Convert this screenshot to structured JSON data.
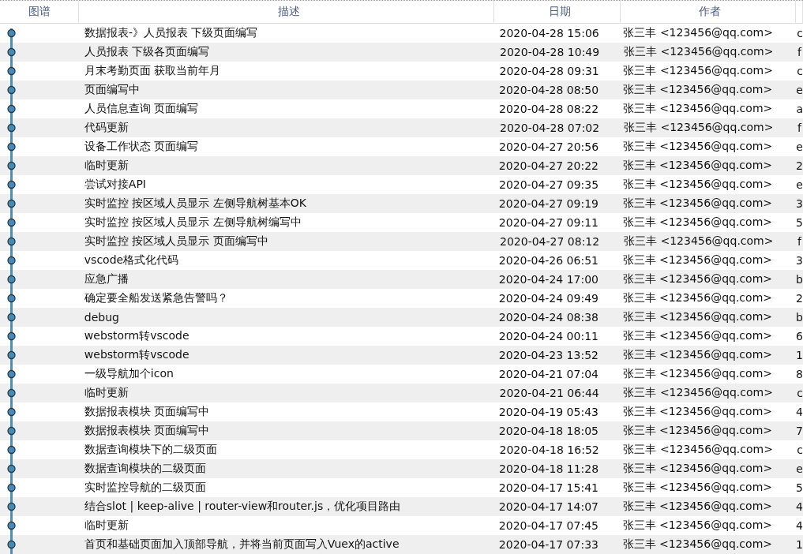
{
  "columns": [
    "图谱",
    "描述",
    "日期",
    "作者"
  ],
  "rows": [
    {
      "description": "数据报表-》人员报表 下级页面编写",
      "date": "2020-04-28 15:06",
      "author": "张三丰 <123456@qq.com>",
      "column_5": "c"
    },
    {
      "description": "人员报表 下级各页面编写",
      "date": "2020-04-28 10:49",
      "author": "张三丰 <123456@qq.com>",
      "column_5": "f"
    },
    {
      "description": "月末考勤页面 获取当前年月",
      "date": "2020-04-28 09:31",
      "author": "张三丰 <123456@qq.com>",
      "column_5": "c"
    },
    {
      "description": "页面编写中",
      "date": "2020-04-28 08:50",
      "author": "张三丰 <123456@qq.com>",
      "column_5": "e"
    },
    {
      "description": "人员信息查询 页面编写",
      "date": "2020-04-28 08:22",
      "author": "张三丰 <123456@qq.com>",
      "column_5": "a"
    },
    {
      "description": "代码更新",
      "date": "2020-04-28 07:02",
      "author": "张三丰 <123456@qq.com>",
      "column_5": "f"
    },
    {
      "description": "设备工作状态 页面编写",
      "date": "2020-04-27 20:56",
      "author": "张三丰 <123456@qq.com>",
      "column_5": "e"
    },
    {
      "description": "临时更新",
      "date": "2020-04-27 20:22",
      "author": "张三丰 <123456@qq.com>",
      "column_5": "2"
    },
    {
      "description": "尝试对接API",
      "date": "2020-04-27 09:35",
      "author": "张三丰 <123456@qq.com>",
      "column_5": "e"
    },
    {
      "description": "实时监控 按区域人员显示 左侧导航树基本OK",
      "date": "2020-04-27 09:19",
      "author": "张三丰 <123456@qq.com>",
      "column_5": "3"
    },
    {
      "description": "实时监控 按区域人员显示 左侧导航树编写中",
      "date": "2020-04-27 09:11",
      "author": "张三丰 <123456@qq.com>",
      "column_5": "5"
    },
    {
      "description": "实时监控 按区域人员显示 页面编写中",
      "date": "2020-04-27 08:12",
      "author": "张三丰 <123456@qq.com>",
      "column_5": "f"
    },
    {
      "description": "vscode格式化代码",
      "date": "2020-04-26 06:51",
      "author": "张三丰 <123456@qq.com>",
      "column_5": "3"
    },
    {
      "description": "应急广播",
      "date": "2020-04-24 17:00",
      "author": "张三丰 <123456@qq.com>",
      "column_5": "b"
    },
    {
      "description": "确定要全船发送紧急告警吗？",
      "date": "2020-04-24 09:49",
      "author": "张三丰 <123456@qq.com>",
      "column_5": "2"
    },
    {
      "description": "debug",
      "date": "2020-04-24 08:38",
      "author": "张三丰 <123456@qq.com>",
      "column_5": "b"
    },
    {
      "description": "webstorm转vscode",
      "date": "2020-04-24 00:11",
      "author": "张三丰 <123456@qq.com>",
      "column_5": "6"
    },
    {
      "description": "webstorm转vscode",
      "date": "2020-04-23 13:52",
      "author": "张三丰 <123456@qq.com>",
      "column_5": "1"
    },
    {
      "description": "一级导航加个icon",
      "date": "2020-04-21 07:04",
      "author": "张三丰 <123456@qq.com>",
      "column_5": "8"
    },
    {
      "description": "临时更新",
      "date": "2020-04-21 06:44",
      "author": "张三丰 <123456@qq.com>",
      "column_5": "c"
    },
    {
      "description": "数据报表模块 页面编写中",
      "date": "2020-04-19 05:43",
      "author": "张三丰 <123456@qq.com>",
      "column_5": "4"
    },
    {
      "description": "数据报表模块 页面编写中",
      "date": "2020-04-18 18:05",
      "author": "张三丰 <123456@qq.com>",
      "column_5": "7"
    },
    {
      "description": "数据查询模块下的二级页面",
      "date": "2020-04-18 16:52",
      "author": "张三丰 <123456@qq.com>",
      "column_5": "c"
    },
    {
      "description": "数据查询模块的二级页面",
      "date": "2020-04-18 11:28",
      "author": "张三丰 <123456@qq.com>",
      "column_5": "e"
    },
    {
      "description": "实时监控导航的二级页面",
      "date": "2020-04-17 15:41",
      "author": "张三丰 <123456@qq.com>",
      "column_5": "5"
    },
    {
      "description": "结合slot | keep-alive | router-view和router.js，优化项目路由",
      "date": "2020-04-17 14:07",
      "author": "张三丰 <123456@qq.com>",
      "column_5": "4"
    },
    {
      "description": "临时更新",
      "date": "2020-04-17 07:45",
      "author": "张三丰 <123456@qq.com>",
      "column_5": "4"
    },
    {
      "description": "首页和基础页面加入顶部导航，并将当前页面写入Vuex的active",
      "date": "2020-04-17 07:33",
      "author": "张三丰 <123456@qq.com>",
      "column_5": "1"
    }
  ]
}
